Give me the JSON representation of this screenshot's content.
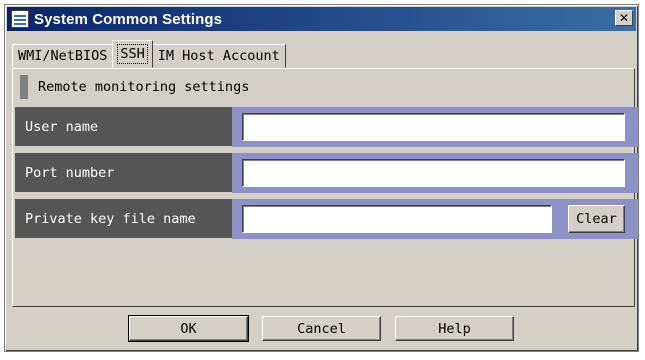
{
  "window": {
    "title": "System Common Settings",
    "close_glyph": "✕",
    "icon": "settings-app-icon"
  },
  "tabs": [
    {
      "label": "WMI/NetBIOS",
      "active": false
    },
    {
      "label": "SSH",
      "active": true
    },
    {
      "label": "IM Host Account",
      "active": false
    }
  ],
  "section": {
    "title": "Remote monitoring settings"
  },
  "fields": {
    "user_name": {
      "label": "User name",
      "value": "",
      "placeholder": ""
    },
    "port_number": {
      "label": "Port number",
      "value": "",
      "placeholder": ""
    },
    "private_key": {
      "label": "Private key file name",
      "value": "",
      "placeholder": ""
    }
  },
  "buttons": {
    "clear": "Clear",
    "ok": "OK",
    "cancel": "Cancel",
    "help": "Help"
  },
  "colors": {
    "titlebar_start": "#0a246a",
    "titlebar_end": "#3a6ea5",
    "label_bg": "#555555",
    "row_accent": "#8f90c6",
    "dialog_bg": "#d4d0c8"
  }
}
